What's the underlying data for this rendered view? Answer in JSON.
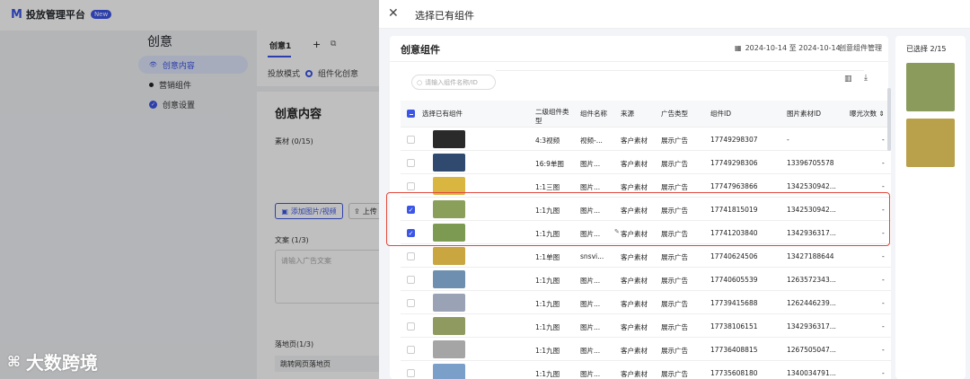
{
  "app": {
    "title": "投放管理平台",
    "badge": "New",
    "logo": "M"
  },
  "sidebar": {
    "title": "创意",
    "items": [
      {
        "label": "创意内容",
        "active": true
      },
      {
        "label": "营销组件",
        "active": false
      },
      {
        "label": "创意设置",
        "active": false
      }
    ]
  },
  "editor": {
    "tab": "创意1",
    "add": "+",
    "mode_label": "投放模式",
    "mode_value": "组件化创意",
    "content_title": "创意内容",
    "material_label": "素材 (0/15)",
    "add_media": "添加图片/视频",
    "upload": "上传",
    "copy_label": "文案 (1/3)",
    "copy_placeholder": "请输入广告文案",
    "landing_label": "落地页(1/3)",
    "landing_value": "跳转网页落地页"
  },
  "watermark": "大数跨境",
  "drawer": {
    "title": "选择已有组件",
    "close": "✕",
    "panel_title": "创意组件",
    "date_range": "2024-10-14 至 2024-10-14",
    "manage": "创意组件管理",
    "search_placeholder": "请输入组件名称/ID",
    "columns": [
      "选择已有组件",
      "二级组件类型",
      "组件名称",
      "来源",
      "广告类型",
      "组件ID",
      "图片素材ID",
      "曝光次数"
    ],
    "rows": [
      {
        "checked": false,
        "thumb": "#2a2a2a",
        "type": "4:3视频",
        "name": "视频-...",
        "source": "客户素材",
        "ad_type": "展示广告",
        "id": "17749298307",
        "img_id": "-",
        "exposure": "-"
      },
      {
        "checked": false,
        "thumb": "#2f4a6e",
        "type": "16:9单图",
        "name": "图片...",
        "source": "客户素材",
        "ad_type": "展示广告",
        "id": "17749298306",
        "img_id": "13396705578",
        "exposure": "-"
      },
      {
        "checked": false,
        "thumb": "#d9b640",
        "type": "1:1三图",
        "name": "图片...",
        "source": "客户素材",
        "ad_type": "展示广告",
        "id": "17747963866",
        "img_id": "1342530942...",
        "exposure": "-"
      },
      {
        "checked": true,
        "thumb": "#8aa05a",
        "type": "1:1九图",
        "name": "图片...",
        "source": "客户素材",
        "ad_type": "展示广告",
        "id": "17741815019",
        "img_id": "1342530942...",
        "exposure": "-"
      },
      {
        "checked": true,
        "thumb": "#7c9a52",
        "type": "1:1九图",
        "name": "图片...",
        "source": "客户素材",
        "ad_type": "展示广告",
        "id": "17741203840",
        "img_id": "1342936317...",
        "exposure": "-"
      },
      {
        "checked": false,
        "thumb": "#c9a640",
        "type": "1:1单图",
        "name": "snsvi...",
        "source": "客户素材",
        "ad_type": "展示广告",
        "id": "17740624506",
        "img_id": "13427188644",
        "exposure": "-"
      },
      {
        "checked": false,
        "thumb": "#6f8fb0",
        "type": "1:1九图",
        "name": "图片...",
        "source": "客户素材",
        "ad_type": "展示广告",
        "id": "17740605539",
        "img_id": "1263572343...",
        "exposure": "-"
      },
      {
        "checked": false,
        "thumb": "#9aa3b5",
        "type": "1:1九图",
        "name": "图片...",
        "source": "客户素材",
        "ad_type": "展示广告",
        "id": "17739415688",
        "img_id": "1262446239...",
        "exposure": "-"
      },
      {
        "checked": false,
        "thumb": "#8e9a60",
        "type": "1:1九图",
        "name": "图片...",
        "source": "客户素材",
        "ad_type": "展示广告",
        "id": "17738106151",
        "img_id": "1342936317...",
        "exposure": "-"
      },
      {
        "checked": false,
        "thumb": "#a5a5a5",
        "type": "1:1九图",
        "name": "图片...",
        "source": "客户素材",
        "ad_type": "展示广告",
        "id": "17736408815",
        "img_id": "1267505047...",
        "exposure": "-"
      },
      {
        "checked": false,
        "thumb": "#7aa0c9",
        "type": "1:1九图",
        "name": "图片...",
        "source": "客户素材",
        "ad_type": "展示广告",
        "id": "17735608180",
        "img_id": "1340034791...",
        "exposure": "-"
      }
    ],
    "selected_title": "已选择 2/15",
    "selected_thumbs": [
      "#8b9b5c",
      "#b9a04a"
    ]
  }
}
